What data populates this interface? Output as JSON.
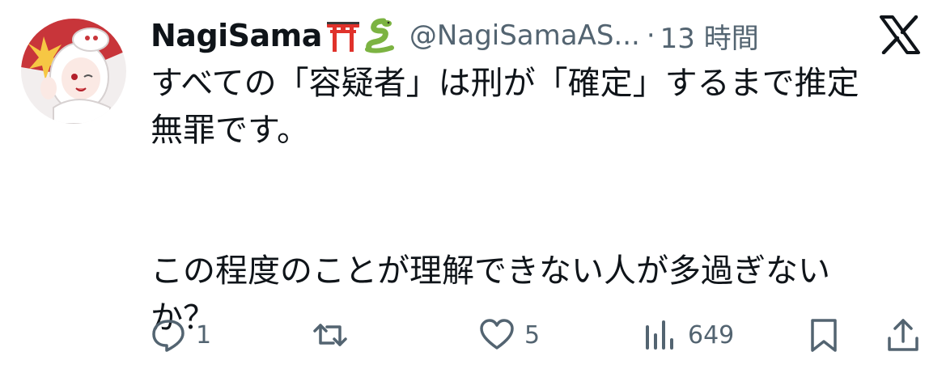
{
  "tweet": {
    "author": {
      "display_name": "NagiSama",
      "name_emojis": [
        "torii-gate-icon",
        "snake-icon"
      ],
      "handle": "@NagiSamaAS...",
      "separator": "·",
      "timestamp": "13 時間"
    },
    "brand_icon": "x-logo-icon",
    "text_lines": [
      "すべての「容疑者」は刑が「確定」するまで推定",
      "無罪です。",
      "",
      "この程度のことが理解できない人が多過ぎない",
      "か？"
    ],
    "actions": {
      "reply_count": "1",
      "retweet_count": "",
      "like_count": "5",
      "views_count": "649"
    },
    "colors": {
      "text": "#0f1419",
      "secondary": "#536471",
      "torii": "#e0322b",
      "snake": "#7cb342"
    }
  }
}
